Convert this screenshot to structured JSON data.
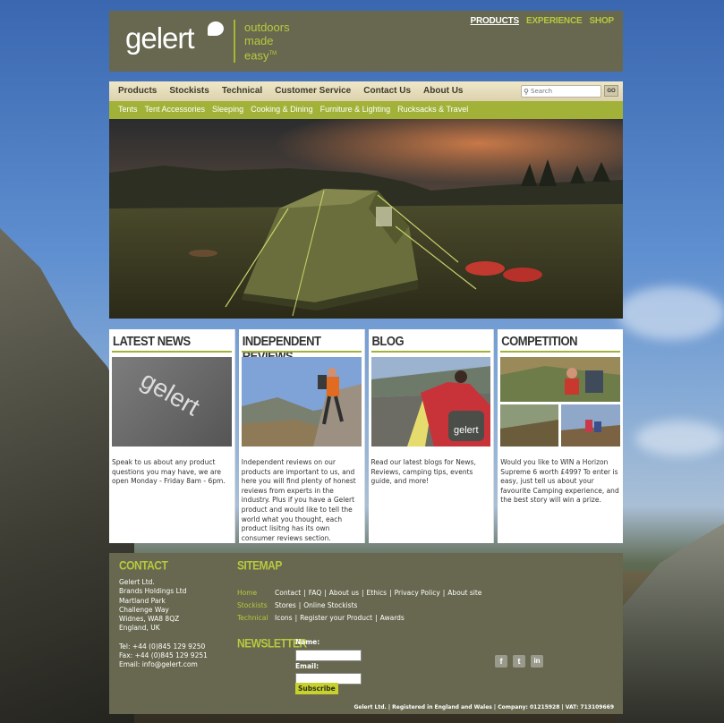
{
  "brand": {
    "logo_text": "gelert",
    "tagline": [
      "outdoors",
      "made",
      "easy"
    ],
    "tagline_mark": "TM"
  },
  "top_nav": [
    {
      "label": "PRODUCTS",
      "active": true
    },
    {
      "label": "EXPERIENCE",
      "active": false
    },
    {
      "label": "SHOP",
      "active": false
    }
  ],
  "main_nav": [
    "Products",
    "Stockists",
    "Technical",
    "Customer Service",
    "Contact Us",
    "About Us"
  ],
  "search": {
    "placeholder": "Search",
    "button": "GO"
  },
  "sub_nav": [
    "Tents",
    "Tent Accessories",
    "Sleeping",
    "Cooking & Dining",
    "Furniture & Lighting",
    "Rucksacks & Travel"
  ],
  "columns": [
    {
      "title": "LATEST NEWS",
      "photo_text": "gelert",
      "text": "Speak to us about any product questions you may have, we are open Monday - Friday 8am - 6pm."
    },
    {
      "title": "INDEPENDENT REVIEWS",
      "text": "Independent reviews on our products are important to us, and here you will find plenty of honest reviews from experts in the industry. Plus if you have a Gelert product and would like to tell the world what you thought, each product lisitng has its own consumer reviews section."
    },
    {
      "title": "BLOG",
      "photo_text": "gelert",
      "text": "Read our latest blogs for News, Reviews, camping tips, events guide, and more!"
    },
    {
      "title": "COMPETITION",
      "text": "Would you like to WIN a Horizon Supreme 6 worth £499? To enter is easy, just tell us about your favourite Camping experience, and the best story will win a prize."
    }
  ],
  "footer": {
    "contact_title": "CONTACT",
    "address": [
      "Gelert Ltd.",
      "Brands Holdings Ltd",
      "Martland Park",
      "Challenge Way",
      "Widnes, WA8 8QZ",
      "England, UK"
    ],
    "phone": [
      "Tel: +44 (0)845 129 9250",
      "Fax: +44 (0)845 129 9251",
      "Email: info@gelert.com"
    ],
    "sitemap_title": "SITEMAP",
    "sitemap": [
      {
        "label": "Home",
        "links": [
          "Contact",
          "FAQ",
          "About us",
          "Ethics",
          "Privacy Policy",
          "About site"
        ]
      },
      {
        "label": "Stockists",
        "links": [
          "Stores",
          "Online Stockists"
        ]
      },
      {
        "label": "Technical",
        "links": [
          "Icons",
          "Register your Product",
          "Awards"
        ]
      }
    ],
    "newsletter_title": "NEWSLETTER",
    "name_label": "Name:",
    "email_label": "Email:",
    "subscribe": "Subscribe",
    "social": [
      "f",
      "t",
      "in"
    ],
    "legal": "Gelert Ltd.  |  Registered in England and Wales  |  Company: 01215928  |  VAT: 713109669"
  },
  "colors": {
    "header_bg": "#67684f",
    "accent_green": "#a2b238",
    "nav_bg": "#efe7c8",
    "footer_bg": "#67684f"
  }
}
